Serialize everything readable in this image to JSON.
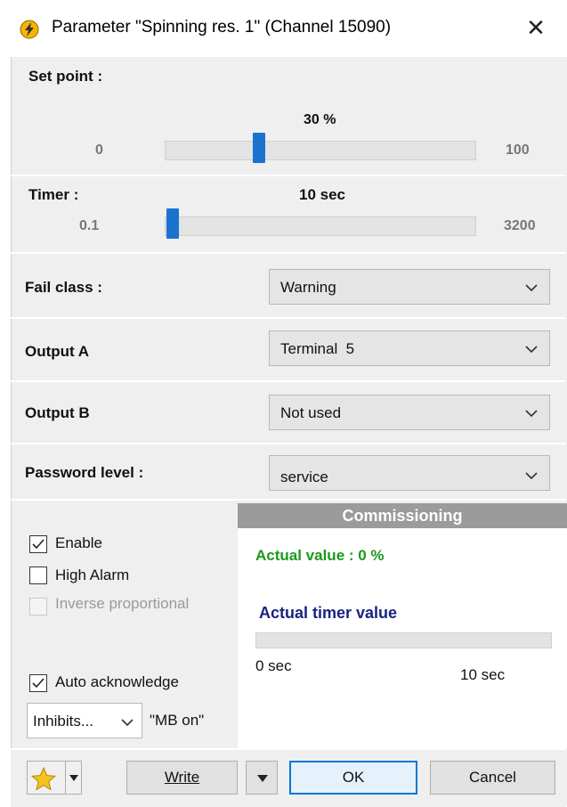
{
  "window": {
    "title": "Parameter \"Spinning res. 1\" (Channel 15090)",
    "close_glyph": "✕"
  },
  "setpoint": {
    "label": "Set point :",
    "value_text": "30 %",
    "min": "0",
    "max": "100",
    "value": 30
  },
  "timer": {
    "label": "Timer :",
    "value_text": "10 sec",
    "min": "0.1",
    "max": "3200",
    "value": 10
  },
  "fail_class": {
    "label": "Fail class :",
    "selected": "Warning"
  },
  "output_a": {
    "label": "Output A",
    "selected": "Terminal  5"
  },
  "output_b": {
    "label": "Output B",
    "selected": "Not used"
  },
  "password_level": {
    "label": "Password level :",
    "selected": "service"
  },
  "options": {
    "enable": {
      "label": "Enable",
      "checked": true
    },
    "high_alarm": {
      "label": "High Alarm",
      "checked": false
    },
    "inverse_proportional": {
      "label": "Inverse proportional",
      "checked": false,
      "disabled": true
    },
    "auto_acknowledge": {
      "label": "Auto acknowledge",
      "checked": true
    },
    "inhibits_select": "Inhibits...",
    "inhibits_value": "\"MB on\""
  },
  "commissioning": {
    "header": "Commissioning",
    "actual_value": "Actual value : 0 %",
    "actual_timer_label": "Actual timer value",
    "timer_min": "0 sec",
    "timer_max": "10 sec",
    "timer_progress": 0,
    "colors": {
      "actual_value": "#1a9a1a",
      "actual_timer_label": "#1a237e"
    }
  },
  "footer": {
    "write_label": "Write",
    "ok_label": "OK",
    "cancel_label": "Cancel",
    "favorites_icon": "star-icon"
  },
  "colors": {
    "accent": "#1a73d0",
    "ok_border": "#0078d7"
  }
}
